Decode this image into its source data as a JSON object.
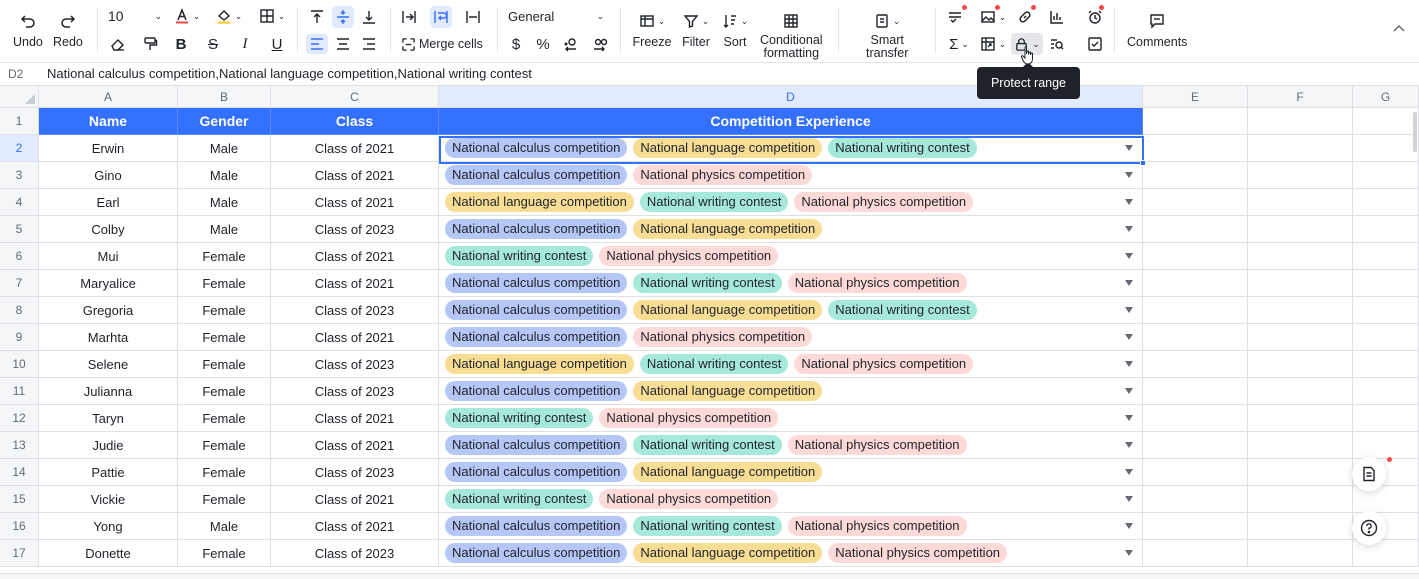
{
  "toolbar": {
    "undo_label": "Undo",
    "redo_label": "Redo",
    "font_size": "10",
    "number_format": "General",
    "merge_label": "Merge cells",
    "currency_symbol": "$",
    "percent_symbol": "%",
    "freeze_label": "Freeze",
    "filter_label": "Filter",
    "sort_label": "Sort",
    "conditional_label_1": "Conditional",
    "conditional_label_2": "formatting",
    "smart_label_1": "Smart",
    "smart_label_2": "transfer",
    "comments_label": "Comments",
    "tooltip": "Protect range",
    "accent_color": "#3370ff",
    "notify_color": "#f54a45"
  },
  "formula_bar": {
    "cell_ref": "D2",
    "content": "National calculus competition,National language competition,National writing contest"
  },
  "columns": [
    "A",
    "B",
    "C",
    "D",
    "E",
    "F",
    "G"
  ],
  "header": {
    "name": "Name",
    "gender": "Gender",
    "class": "Class",
    "experience": "Competition Experience"
  },
  "tag_colors": {
    "calc": "#b4c7f7",
    "lang": "#f8dd95",
    "write": "#a6e9da",
    "phys": "#fdd9d7"
  },
  "rows": [
    {
      "num": "2",
      "name": "Erwin",
      "gender": "Male",
      "class": "Class of 2021",
      "tags": [
        [
          "calc",
          "National calculus competition"
        ],
        [
          "lang",
          "National language competition"
        ],
        [
          "write",
          "National writing contest"
        ]
      ]
    },
    {
      "num": "3",
      "name": "Gino",
      "gender": "Male",
      "class": "Class of 2021",
      "tags": [
        [
          "calc",
          "National calculus competition"
        ],
        [
          "phys",
          "National physics competition"
        ]
      ]
    },
    {
      "num": "4",
      "name": "Earl",
      "gender": "Male",
      "class": "Class of 2021",
      "tags": [
        [
          "lang",
          "National language competition"
        ],
        [
          "write",
          "National writing contest"
        ],
        [
          "phys",
          "National physics competition"
        ]
      ]
    },
    {
      "num": "5",
      "name": "Colby",
      "gender": "Male",
      "class": "Class of 2023",
      "tags": [
        [
          "calc",
          "National calculus competition"
        ],
        [
          "lang",
          "National language competition"
        ]
      ]
    },
    {
      "num": "6",
      "name": "Mui",
      "gender": "Female",
      "class": "Class of 2021",
      "tags": [
        [
          "write",
          "National writing contest"
        ],
        [
          "phys",
          "National physics competition"
        ]
      ]
    },
    {
      "num": "7",
      "name": "Maryalice",
      "gender": "Female",
      "class": "Class of 2021",
      "tags": [
        [
          "calc",
          "National calculus competition"
        ],
        [
          "write",
          "National writing contest"
        ],
        [
          "phys",
          "National physics competition"
        ]
      ]
    },
    {
      "num": "8",
      "name": "Gregoria",
      "gender": "Female",
      "class": "Class of 2023",
      "tags": [
        [
          "calc",
          "National calculus competition"
        ],
        [
          "lang",
          "National language competition"
        ],
        [
          "write",
          "National writing contest"
        ]
      ]
    },
    {
      "num": "9",
      "name": "Marhta",
      "gender": "Female",
      "class": "Class of 2021",
      "tags": [
        [
          "calc",
          "National calculus competition"
        ],
        [
          "phys",
          "National physics competition"
        ]
      ]
    },
    {
      "num": "10",
      "name": "Selene",
      "gender": "Female",
      "class": "Class of 2023",
      "tags": [
        [
          "lang",
          "National language competition"
        ],
        [
          "write",
          "National writing contest"
        ],
        [
          "phys",
          "National physics competition"
        ]
      ]
    },
    {
      "num": "11",
      "name": "Julianna",
      "gender": "Female",
      "class": "Class of 2023",
      "tags": [
        [
          "calc",
          "National calculus competition"
        ],
        [
          "lang",
          "National language competition"
        ]
      ]
    },
    {
      "num": "12",
      "name": "Taryn",
      "gender": "Female",
      "class": "Class of 2021",
      "tags": [
        [
          "write",
          "National writing contest"
        ],
        [
          "phys",
          "National physics competition"
        ]
      ]
    },
    {
      "num": "13",
      "name": "Judie",
      "gender": "Female",
      "class": "Class of 2021",
      "tags": [
        [
          "calc",
          "National calculus competition"
        ],
        [
          "write",
          "National writing contest"
        ],
        [
          "phys",
          "National physics competition"
        ]
      ]
    },
    {
      "num": "14",
      "name": "Pattie",
      "gender": "Female",
      "class": "Class of 2023",
      "tags": [
        [
          "calc",
          "National calculus competition"
        ],
        [
          "lang",
          "National language competition"
        ]
      ]
    },
    {
      "num": "15",
      "name": "Vickie",
      "gender": "Female",
      "class": "Class of 2021",
      "tags": [
        [
          "write",
          "National writing contest"
        ],
        [
          "phys",
          "National physics competition"
        ]
      ]
    },
    {
      "num": "16",
      "name": "Yong",
      "gender": "Male",
      "class": "Class of 2021",
      "tags": [
        [
          "calc",
          "National calculus competition"
        ],
        [
          "write",
          "National writing contest"
        ],
        [
          "phys",
          "National physics competition"
        ]
      ]
    },
    {
      "num": "17",
      "name": "Donette",
      "gender": "Female",
      "class": "Class of 2023",
      "tags": [
        [
          "calc",
          "National calculus competition"
        ],
        [
          "lang",
          "National language competition"
        ],
        [
          "phys",
          "National physics competition"
        ]
      ]
    }
  ]
}
